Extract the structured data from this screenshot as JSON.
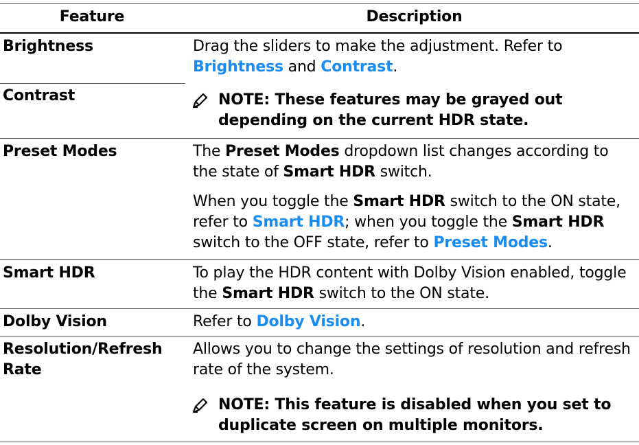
{
  "header": {
    "feature": "Feature",
    "description": "Description"
  },
  "rows": {
    "brightness": {
      "feature": "Brightness",
      "desc_text": "Drag the sliders to make the adjustment. Refer to",
      "link1": "Brightness",
      "and": "and",
      "link2": "Contrast",
      "end": "."
    },
    "contrast": {
      "feature": "Contrast",
      "note": "NOTE: These features may be grayed out depending on the current HDR state."
    },
    "preset_modes": {
      "feature": "Preset Modes",
      "p1_a": "The",
      "p1_b": "Preset Modes",
      "p1_c": "dropdown list changes according to the state of",
      "p1_d": "Smart HDR",
      "p1_e": "switch.",
      "p2_a": "When you toggle the",
      "p2_b": "Smart HDR",
      "p2_c": "switch to the ON state, refer to",
      "p2_link1": "Smart HDR",
      "p2_d": "; when you toggle the",
      "p2_e": "Smart HDR",
      "p2_f": "switch to the OFF state, refer to",
      "p2_link2": "Preset Modes",
      "p2_g": "."
    },
    "smart_hdr": {
      "feature": "Smart HDR",
      "a": "To play the HDR content with Dolby Vision enabled, toggle the",
      "b": "Smart HDR",
      "c": "switch to the ON state."
    },
    "dolby_vision": {
      "feature": "Dolby Vision",
      "a": "Refer to",
      "link": "Dolby Vision",
      "b": "."
    },
    "resolution": {
      "feature": "Resolution/Refresh Rate",
      "desc": "Allows you to change the settings of resolution and refresh rate of the system.",
      "note": "NOTE: This feature is disabled when you set to duplicate screen on multiple monitors."
    }
  },
  "colors": {
    "link": "#1a8cf0",
    "rule": "#000000"
  }
}
